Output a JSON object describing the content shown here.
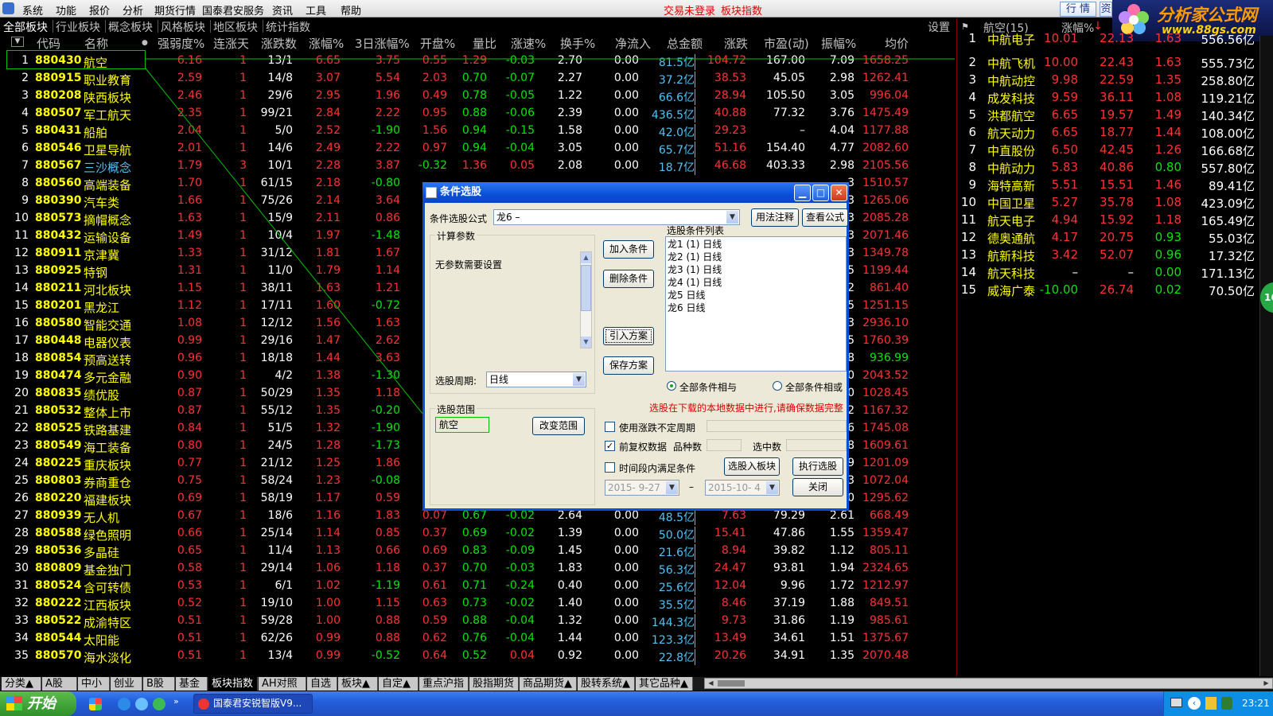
{
  "menu": {
    "items": [
      "系统",
      "功能",
      "报价",
      "分析",
      "期货行情",
      "国泰君安服务",
      "资讯",
      "工具",
      "帮助"
    ],
    "alert_login": "交易未登录",
    "alert_index": "板块指数",
    "btn_quote": "行 情",
    "btn_close_partial": "资"
  },
  "logo": {
    "title": "分析家公式网",
    "url": "www.88gs.com"
  },
  "tabs": {
    "items": [
      "全部板块",
      "行业板块",
      "概念板块",
      "风格板块",
      "地区板块",
      "统计指数"
    ],
    "setting": "设置"
  },
  "table": {
    "headers": [
      "代码",
      "名称",
      "强弱度%",
      "连涨天",
      "涨跌数",
      "涨幅%",
      "3日涨幅%",
      "开盘%",
      "量比",
      "涨速%",
      "换手%",
      "净流入",
      "总金额",
      "涨跌",
      "市盈(动)",
      "振幅%",
      "均价"
    ],
    "rows": [
      [
        "1",
        "880430",
        "航空",
        "6.16",
        "1",
        "13/1",
        "6.65",
        "3.75",
        "0.55",
        "1.29",
        "-0.03",
        "2.70",
        "0.00",
        "81.5亿",
        "104.72",
        "167.00",
        "7.09",
        "1658.25"
      ],
      [
        "2",
        "880915",
        "职业教育",
        "2.59",
        "1",
        "14/8",
        "3.07",
        "5.54",
        "2.03",
        "0.70",
        "-0.07",
        "2.27",
        "0.00",
        "37.2亿",
        "38.53",
        "45.05",
        "2.98",
        "1262.41"
      ],
      [
        "3",
        "880208",
        "陕西板块",
        "2.46",
        "1",
        "29/6",
        "2.95",
        "1.96",
        "0.49",
        "0.78",
        "-0.05",
        "1.22",
        "0.00",
        "66.6亿",
        "28.94",
        "105.50",
        "3.05",
        "996.04"
      ],
      [
        "4",
        "880507",
        "军工航天",
        "2.35",
        "1",
        "99/21",
        "2.84",
        "2.22",
        "0.95",
        "0.88",
        "-0.06",
        "2.39",
        "0.00",
        "436.5亿",
        "40.88",
        "77.32",
        "3.76",
        "1475.49"
      ],
      [
        "5",
        "880431",
        "船舶",
        "2.04",
        "1",
        "5/0",
        "2.52",
        "-1.90",
        "1.56",
        "0.94",
        "-0.15",
        "1.58",
        "0.00",
        "42.0亿",
        "29.23",
        "–",
        "4.04",
        "1177.88"
      ],
      [
        "6",
        "880546",
        "卫星导航",
        "2.01",
        "1",
        "14/6",
        "2.49",
        "2.22",
        "0.97",
        "0.94",
        "-0.04",
        "3.05",
        "0.00",
        "65.7亿",
        "51.16",
        "154.40",
        "4.77",
        "2082.60"
      ],
      [
        "7",
        "880567",
        "三沙概念",
        "1.79",
        "3",
        "10/1",
        "2.28",
        "3.87",
        "-0.32",
        "1.36",
        "0.05",
        "2.08",
        "0.00",
        "18.7亿",
        "46.68",
        "403.33",
        "2.98",
        "2105.56"
      ],
      [
        "8",
        "880560",
        "高端装备",
        "1.70",
        "1",
        "61/15",
        "2.18",
        "-0.80",
        "",
        "",
        "",
        "",
        "",
        "",
        "",
        "",
        "3",
        "1510.57"
      ],
      [
        "9",
        "880390",
        "汽车类",
        "1.66",
        "1",
        "75/26",
        "2.14",
        "3.64",
        "",
        "",
        "",
        "",
        "",
        "",
        "",
        "",
        "3",
        "1265.06"
      ],
      [
        "10",
        "880573",
        "摘帽概念",
        "1.63",
        "1",
        "15/9",
        "2.11",
        "0.86",
        "",
        "",
        "",
        "",
        "",
        "",
        "",
        "",
        "3",
        "2085.28"
      ],
      [
        "11",
        "880432",
        "运输设备",
        "1.49",
        "1",
        "10/4",
        "1.97",
        "-1.48",
        "",
        "",
        "",
        "",
        "",
        "",
        "",
        "",
        "3",
        "2071.46"
      ],
      [
        "12",
        "880911",
        "京津冀",
        "1.33",
        "1",
        "31/12",
        "1.81",
        "1.67",
        "",
        "",
        "",
        "",
        "",
        "",
        "",
        "",
        "3",
        "1349.78"
      ],
      [
        "13",
        "880925",
        "特钢",
        "1.31",
        "1",
        "11/0",
        "1.79",
        "1.14",
        "",
        "",
        "",
        "",
        "",
        "",
        "",
        "",
        "5",
        "1199.44"
      ],
      [
        "14",
        "880211",
        "河北板块",
        "1.15",
        "1",
        "38/11",
        "1.63",
        "1.21",
        "",
        "",
        "",
        "",
        "",
        "",
        "",
        "",
        "2",
        "861.40"
      ],
      [
        "15",
        "880201",
        "黑龙江",
        "1.12",
        "1",
        "17/11",
        "1.60",
        "-0.72",
        "",
        "",
        "",
        "",
        "",
        "",
        "",
        "",
        "5",
        "1251.15"
      ],
      [
        "16",
        "880580",
        "智能交通",
        "1.08",
        "1",
        "12/12",
        "1.56",
        "1.63",
        "",
        "",
        "",
        "",
        "",
        "",
        "",
        "",
        "3",
        "2936.10"
      ],
      [
        "17",
        "880448",
        "电器仪表",
        "0.99",
        "1",
        "29/16",
        "1.47",
        "2.62",
        "",
        "",
        "",
        "",
        "",
        "",
        "",
        "",
        "5",
        "1760.39"
      ],
      [
        "18",
        "880854",
        "预高送转",
        "0.96",
        "1",
        "18/18",
        "1.44",
        "3.63",
        "",
        "",
        "",
        "",
        "",
        "",
        "",
        "",
        "8",
        "936.99"
      ],
      [
        "19",
        "880474",
        "多元金融",
        "0.90",
        "1",
        "4/2",
        "1.38",
        "-1.30",
        "",
        "",
        "",
        "",
        "",
        "",
        "",
        "",
        "0",
        "2043.52"
      ],
      [
        "20",
        "880835",
        "绩优股",
        "0.87",
        "1",
        "50/29",
        "1.35",
        "1.18",
        "",
        "",
        "",
        "",
        "",
        "",
        "",
        "",
        "0",
        "1028.45"
      ],
      [
        "21",
        "880532",
        "整体上市",
        "0.87",
        "1",
        "55/12",
        "1.35",
        "-0.20",
        "",
        "",
        "",
        "",
        "",
        "",
        "",
        "",
        "2",
        "1167.32"
      ],
      [
        "22",
        "880525",
        "铁路基建",
        "0.84",
        "1",
        "51/5",
        "1.32",
        "-1.90",
        "",
        "",
        "",
        "",
        "",
        "",
        "",
        "",
        "6",
        "1745.08"
      ],
      [
        "23",
        "880549",
        "海工装备",
        "0.80",
        "1",
        "24/5",
        "1.28",
        "-1.73",
        "",
        "",
        "",
        "",
        "",
        "",
        "",
        "",
        "8",
        "1609.61"
      ],
      [
        "24",
        "880225",
        "重庆板块",
        "0.77",
        "1",
        "21/12",
        "1.25",
        "1.86",
        "",
        "",
        "",
        "",
        "",
        "",
        "",
        "",
        "9",
        "1201.09"
      ],
      [
        "25",
        "880803",
        "券商重仓",
        "0.75",
        "1",
        "58/24",
        "1.23",
        "-0.08",
        "",
        "",
        "",
        "",
        "",
        "",
        "",
        "",
        "3",
        "1072.04"
      ],
      [
        "26",
        "880220",
        "福建板块",
        "0.69",
        "1",
        "58/19",
        "1.17",
        "0.59",
        "",
        "",
        "",
        "",
        "",
        "",
        "",
        "",
        "0",
        "1295.62"
      ],
      [
        "27",
        "880939",
        "无人机",
        "0.67",
        "1",
        "18/6",
        "1.16",
        "1.83",
        "0.07",
        "0.67",
        "-0.02",
        "2.64",
        "0.00",
        "48.5亿",
        "7.63",
        "79.29",
        "2.61",
        "668.49"
      ],
      [
        "28",
        "880588",
        "绿色照明",
        "0.66",
        "1",
        "25/14",
        "1.14",
        "0.85",
        "0.37",
        "0.69",
        "-0.02",
        "1.39",
        "0.00",
        "50.0亿",
        "15.41",
        "47.86",
        "1.55",
        "1359.47"
      ],
      [
        "29",
        "880536",
        "多晶硅",
        "0.65",
        "1",
        "11/4",
        "1.13",
        "0.66",
        "0.69",
        "0.83",
        "-0.09",
        "1.45",
        "0.00",
        "21.6亿",
        "8.94",
        "39.82",
        "1.12",
        "805.11"
      ],
      [
        "30",
        "880809",
        "基金独门",
        "0.58",
        "1",
        "29/14",
        "1.06",
        "1.18",
        "0.37",
        "0.70",
        "-0.03",
        "1.83",
        "0.00",
        "56.3亿",
        "24.47",
        "93.81",
        "1.94",
        "2324.65"
      ],
      [
        "31",
        "880524",
        "含可转债",
        "0.53",
        "1",
        "6/1",
        "1.02",
        "-1.19",
        "0.61",
        "0.71",
        "-0.24",
        "0.40",
        "0.00",
        "25.6亿",
        "12.04",
        "9.96",
        "1.72",
        "1212.97"
      ],
      [
        "32",
        "880222",
        "江西板块",
        "0.52",
        "1",
        "19/10",
        "1.00",
        "1.15",
        "0.63",
        "0.73",
        "-0.02",
        "1.40",
        "0.00",
        "35.5亿",
        "8.46",
        "37.19",
        "1.88",
        "849.51"
      ],
      [
        "33",
        "880522",
        "成渝特区",
        "0.51",
        "1",
        "59/28",
        "1.00",
        "0.88",
        "0.59",
        "0.88",
        "-0.04",
        "1.32",
        "0.00",
        "144.3亿",
        "9.73",
        "31.86",
        "1.19",
        "985.61"
      ],
      [
        "34",
        "880544",
        "太阳能",
        "0.51",
        "1",
        "62/26",
        "0.99",
        "0.88",
        "0.62",
        "0.76",
        "-0.04",
        "1.44",
        "0.00",
        "123.3亿",
        "13.49",
        "34.61",
        "1.51",
        "1375.67"
      ],
      [
        "35",
        "880570",
        "海水淡化",
        "0.51",
        "1",
        "13/4",
        "0.99",
        "-0.52",
        "0.64",
        "0.52",
        "0.04",
        "0.92",
        "0.00",
        "22.8亿",
        "20.26",
        "34.91",
        "1.35",
        "2070.48"
      ]
    ]
  },
  "right_panel": {
    "title": "航空(15)",
    "col_change": "涨幅%",
    "rows": [
      [
        "1",
        "中航电子",
        "10.01",
        "22.13",
        "1.63",
        "556.56亿"
      ],
      [
        "2",
        "中航飞机",
        "10.00",
        "22.43",
        "1.63",
        "555.73亿"
      ],
      [
        "3",
        "中航动控",
        "9.98",
        "22.59",
        "1.35",
        "258.80亿"
      ],
      [
        "4",
        "成发科技",
        "9.59",
        "36.11",
        "1.08",
        "119.21亿"
      ],
      [
        "5",
        "洪都航空",
        "6.65",
        "19.57",
        "1.49",
        "140.34亿"
      ],
      [
        "6",
        "航天动力",
        "6.65",
        "18.77",
        "1.44",
        "108.00亿"
      ],
      [
        "7",
        "中直股份",
        "6.50",
        "42.45",
        "1.26",
        "166.68亿"
      ],
      [
        "8",
        "中航动力",
        "5.83",
        "40.86",
        "0.80",
        "557.80亿"
      ],
      [
        "9",
        "海特高新",
        "5.51",
        "15.51",
        "1.46",
        "89.41亿"
      ],
      [
        "10",
        "中国卫星",
        "5.27",
        "35.78",
        "1.08",
        "423.09亿"
      ],
      [
        "11",
        "航天电子",
        "4.94",
        "15.92",
        "1.18",
        "165.49亿"
      ],
      [
        "12",
        "德奥通航",
        "4.17",
        "20.75",
        "0.93",
        "55.03亿"
      ],
      [
        "13",
        "航新科技",
        "3.42",
        "52.07",
        "0.96",
        "17.32亿"
      ],
      [
        "14",
        "航天科技",
        "–",
        "–",
        "0.00",
        "171.13亿"
      ],
      [
        "15",
        "威海广泰",
        "-10.00",
        "26.74",
        "0.02",
        "70.50亿"
      ]
    ],
    "badge": "16"
  },
  "dialog": {
    "title": "条件选股",
    "formula_label": "条件选股公式",
    "formula_value": "龙6      –",
    "btn_usage": "用法注释",
    "btn_view": "查看公式",
    "calc_params_label": "计算参数",
    "no_params": "无参数需要设置",
    "period_label": "选股周期:",
    "period_value": "日线",
    "range_label": "选股范围",
    "range_value": "航空",
    "btn_change_range": "改变范围",
    "list_label": "选股条件列表",
    "conditions": [
      "龙1 (1) 日线",
      "龙2 (1) 日线",
      "龙3 (1) 日线",
      "龙4 (1) 日线",
      "龙5 日线",
      "龙6 日线"
    ],
    "btn_add": "加入条件",
    "btn_delete": "删除条件",
    "btn_import": "引入方案",
    "btn_save": "保存方案",
    "radio_and": "全部条件相与",
    "radio_or": "全部条件相或",
    "warning": "选股在下载的本地数据中进行,请确保数据完整",
    "chk_variable_period": "使用涨跌不定周期",
    "chk_prev_adjust": "前复权数据",
    "count_label": "品种数",
    "selected_label": "选中数",
    "chk_time_range": "时间段内满足条件",
    "btn_to_block": "选股入板块",
    "btn_execute": "执行选股",
    "date_from": "2015- 9-27",
    "date_to": "2015-10- 4",
    "btn_close": "关闭"
  },
  "bottom_tabs": [
    "分类▲",
    "A股",
    "中小",
    "创业",
    "B股",
    "基金",
    "板块指数",
    "AH对照",
    "自选",
    "板块▲",
    "自定▲",
    "重点沪指",
    "股指期货",
    "商品期货▲",
    "股转系统▲",
    "其它品种▲"
  ],
  "taskbar": {
    "start": "开始",
    "app": "国泰君安锐智版V9...",
    "time": "23:21"
  },
  "colors": {
    "up": "#ff3232",
    "down": "#00e600",
    "code": "#ffff00",
    "amount": "#4fc3f7"
  }
}
